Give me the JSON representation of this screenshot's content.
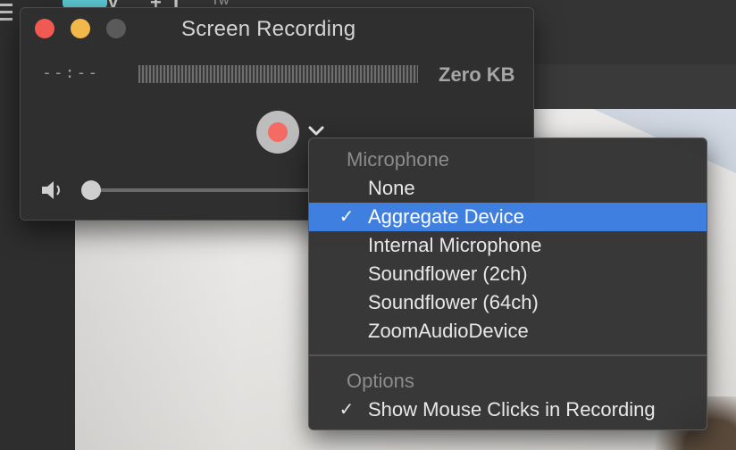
{
  "background": {
    "toolbar_text": "Tw",
    "toolbar_glyphs": [
      "V",
      "+",
      "I"
    ]
  },
  "window": {
    "title": "Screen Recording",
    "elapsed_time": "--:--",
    "file_size": "Zero KB",
    "volume_level": 0.0
  },
  "menu": {
    "microphone_header": "Microphone",
    "microphone_items": [
      {
        "label": "None",
        "checked": false
      },
      {
        "label": "Aggregate Device",
        "checked": true
      },
      {
        "label": "Internal Microphone",
        "checked": false
      },
      {
        "label": "Soundflower (2ch)",
        "checked": false
      },
      {
        "label": "Soundflower (64ch)",
        "checked": false
      },
      {
        "label": "ZoomAudioDevice",
        "checked": false
      }
    ],
    "options_header": "Options",
    "option_items": [
      {
        "label": "Show Mouse Clicks in Recording",
        "checked": true
      }
    ],
    "checkmark": "✓"
  },
  "colors": {
    "selection": "#3e7fe0",
    "close": "#f05a52",
    "minimize": "#f2b84a",
    "record_dot": "#f36b63"
  },
  "icons": {
    "close": "close-icon",
    "minimize": "minimize-icon",
    "zoom": "zoom-icon",
    "record": "record-icon",
    "chevron": "chevron-down-icon",
    "volume": "speaker-icon",
    "check": "checkmark-icon"
  }
}
